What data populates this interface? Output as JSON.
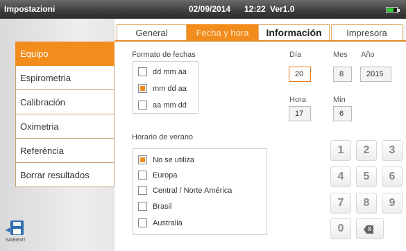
{
  "titlebar": {
    "app_title": "Impostazioni",
    "date": "02/09/2014",
    "time": "12:22",
    "version": "Ver1.0"
  },
  "tabs": [
    {
      "label": "General"
    },
    {
      "label": "Fecha y hora"
    },
    {
      "label": "Información"
    },
    {
      "label": "Impresora"
    }
  ],
  "sidebar": {
    "items": [
      {
        "label": "Equipo"
      },
      {
        "label": "Espirometria"
      },
      {
        "label": "Calibración"
      },
      {
        "label": "Oximetria"
      },
      {
        "label": "Referéncia"
      },
      {
        "label": "Borrar resultados"
      }
    ],
    "save_label": "SAVE/EXIT"
  },
  "date_format": {
    "label": "Formato de fechas",
    "options": [
      {
        "label": "dd mm aa",
        "checked": false
      },
      {
        "label": "mm dd aa",
        "checked": true
      },
      {
        "label": "aa mm dd",
        "checked": false
      }
    ]
  },
  "dst": {
    "label": "Horario de verano",
    "options": [
      {
        "label": "No se utiliza",
        "checked": true
      },
      {
        "label": "Europa",
        "checked": false
      },
      {
        "label": "Central / Norte América",
        "checked": false
      },
      {
        "label": "Brasil",
        "checked": false
      },
      {
        "label": "Australia",
        "checked": false
      }
    ]
  },
  "datetime": {
    "day_label": "Día",
    "month_label": "Mes",
    "year_label": "Año",
    "day": "20",
    "month": "8",
    "year": "2015",
    "hour_label": "Hora",
    "min_label": "Min",
    "hour": "17",
    "min": "6"
  },
  "keypad": {
    "keys": [
      "1",
      "2",
      "3",
      "4",
      "5",
      "6",
      "7",
      "8",
      "9",
      "0"
    ],
    "backspace_label": "X"
  },
  "colors": {
    "accent": "#f28c1c",
    "battery": "#2ed12e"
  }
}
